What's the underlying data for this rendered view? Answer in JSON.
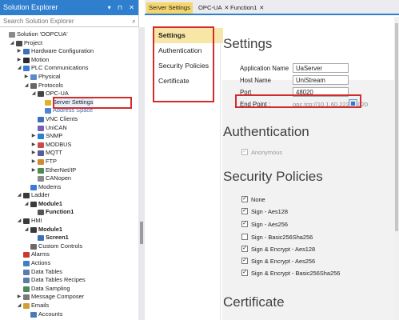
{
  "explorer": {
    "title": "Solution Explorer",
    "title_buttons": "▾ ⊓ ✕",
    "search_placeholder": "Search Solution Explorer",
    "tree": [
      {
        "label": "Solution 'OOPCUA'",
        "level": 0,
        "expand": "",
        "icon": "#8a8a8a",
        "icon_name": "solution-icon"
      },
      {
        "label": "Project",
        "level": 1,
        "expand": "◢",
        "icon": "#4a4a4a",
        "icon_name": "project-icon"
      },
      {
        "label": "Hardware Configuration",
        "level": 2,
        "expand": "▶",
        "icon": "#3b6fb6",
        "icon_name": "hardware-icon"
      },
      {
        "label": "Motion",
        "level": 2,
        "expand": "▶",
        "icon": "#2b2b2b",
        "icon_name": "motion-icon"
      },
      {
        "label": "PLC Communications",
        "level": 2,
        "expand": "◢",
        "icon": "#3a7bd5",
        "icon_name": "plc-communications-icon"
      },
      {
        "label": "Physical",
        "level": 3,
        "expand": "▶",
        "icon": "#5a8ac7",
        "icon_name": "physical-icon"
      },
      {
        "label": "Protocols",
        "level": 3,
        "expand": "◢",
        "icon": "#666666",
        "icon_name": "protocols-icon"
      },
      {
        "label": "OPC-UA",
        "level": 4,
        "expand": "◢",
        "icon": "#444444",
        "icon_name": "opcua-icon"
      },
      {
        "label": "Server Settings",
        "level": 5,
        "expand": "",
        "icon": "#e0b030",
        "icon_name": "server-settings-icon",
        "selected": true
      },
      {
        "label": "Address Space",
        "level": 5,
        "expand": "",
        "icon": "#4c86d0",
        "icon_name": "address-space-icon",
        "muted": true
      },
      {
        "label": "VNC Clients",
        "level": 4,
        "expand": "",
        "icon": "#3c6fb8",
        "icon_name": "vnc-icon"
      },
      {
        "label": "UniCAN",
        "level": 4,
        "expand": "",
        "icon": "#7a5fb0",
        "icon_name": "unican-icon"
      },
      {
        "label": "SNMP",
        "level": 4,
        "expand": "▶",
        "icon": "#2f7fce",
        "icon_name": "snmp-icon"
      },
      {
        "label": "MODBUS",
        "level": 4,
        "expand": "▶",
        "icon": "#c94c4c",
        "icon_name": "modbus-icon"
      },
      {
        "label": "MQTT",
        "level": 4,
        "expand": "▶",
        "icon": "#5b5b9c",
        "icon_name": "mqtt-icon"
      },
      {
        "label": "FTP",
        "level": 4,
        "expand": "▶",
        "icon": "#d08a2c",
        "icon_name": "ftp-icon"
      },
      {
        "label": "EtherNet/IP",
        "level": 4,
        "expand": "▶",
        "icon": "#4d8a4d",
        "icon_name": "ethernet-ip-icon"
      },
      {
        "label": "CANopen",
        "level": 4,
        "expand": "",
        "icon": "#8a8a8a",
        "icon_name": "canopen-icon"
      },
      {
        "label": "Modems",
        "level": 3,
        "expand": "",
        "icon": "#3a7bd5",
        "icon_name": "modems-icon"
      },
      {
        "label": "Ladder",
        "level": 2,
        "expand": "◢",
        "icon": "#3a3a3a",
        "icon_name": "ladder-icon"
      },
      {
        "label": "Module1",
        "level": 3,
        "expand": "◢",
        "icon": "#3a3a3a",
        "icon_name": "module-icon",
        "bold": true
      },
      {
        "label": "Function1",
        "level": 4,
        "expand": "",
        "icon": "#555555",
        "icon_name": "function-icon",
        "bold": true
      },
      {
        "label": "HMI",
        "level": 2,
        "expand": "◢",
        "icon": "#3a3a3a",
        "icon_name": "hmi-icon"
      },
      {
        "label": "Module1",
        "level": 3,
        "expand": "◢",
        "icon": "#3a3a3a",
        "icon_name": "module-icon",
        "bold": true
      },
      {
        "label": "Screen1",
        "level": 4,
        "expand": "",
        "icon": "#3c6fb8",
        "icon_name": "screen-icon",
        "bold": true
      },
      {
        "label": "Custom Controls",
        "level": 3,
        "expand": "",
        "icon": "#6a6a6a",
        "icon_name": "custom-controls-icon"
      },
      {
        "label": "Alarms",
        "level": 2,
        "expand": "",
        "icon": "#c93a2e",
        "icon_name": "alarms-icon"
      },
      {
        "label": "Actions",
        "level": 2,
        "expand": "",
        "icon": "#3f7fc4",
        "icon_name": "actions-icon"
      },
      {
        "label": "Data Tables",
        "level": 2,
        "expand": "",
        "icon": "#5a7da8",
        "icon_name": "data-tables-icon"
      },
      {
        "label": "Data Tables Recipes",
        "level": 2,
        "expand": "",
        "icon": "#5a7da8",
        "icon_name": "recipes-icon"
      },
      {
        "label": "Data Sampling",
        "level": 2,
        "expand": "",
        "icon": "#4a8a5a",
        "icon_name": "data-sampling-icon"
      },
      {
        "label": "Message Composer",
        "level": 2,
        "expand": "▶",
        "icon": "#7a7a7a",
        "icon_name": "message-composer-icon"
      },
      {
        "label": "Emails",
        "level": 2,
        "expand": "◢",
        "icon": "#d0a030",
        "icon_name": "emails-icon"
      },
      {
        "label": "Accounts",
        "level": 3,
        "expand": "",
        "icon": "#4a7ab8",
        "icon_name": "accounts-icon"
      }
    ]
  },
  "tabs": [
    {
      "label": "Server Settings",
      "active": true
    },
    {
      "label": "OPC-UA",
      "active": false
    },
    {
      "label": "Function1",
      "active": false
    }
  ],
  "tab_close_glyph": "✕",
  "nav": {
    "items": [
      "Settings",
      "Authentication",
      "Security Policies",
      "Certificate"
    ],
    "active_index": 0
  },
  "settings": {
    "title": "Settings",
    "application_name_label": "Application Name",
    "application_name_value": "UaServer",
    "host_name_label": "Host Name",
    "host_name_value": "UniStream",
    "port_label": "Port",
    "port_value": "48020",
    "endpoint_label": "End Point :",
    "endpoint_value": "opc.tcp://10.1.60.222:48020"
  },
  "authentication": {
    "title": "Authentication",
    "anonymous_label": "Anonymous",
    "anonymous_checked": true
  },
  "security": {
    "title": "Security Policies",
    "policies": [
      {
        "label": "None",
        "checked": true
      },
      {
        "label": "Sign - Aes128",
        "checked": true
      },
      {
        "label": "Sign - Aes256",
        "checked": true
      },
      {
        "label": "Sign - Basic256Sha256",
        "checked": false
      },
      {
        "label": "Sign & Encrypt - Aes128",
        "checked": true
      },
      {
        "label": "Sign & Encrypt - Aes256",
        "checked": true
      },
      {
        "label": "Sign & Encrypt - Basic256Sha256",
        "checked": true
      }
    ]
  },
  "certificate": {
    "title": "Certificate"
  },
  "colors": {
    "accent": "#2f7fce",
    "highlight_box": "#d42b2b",
    "active_tab": "#f5d66e",
    "active_nav": "#f7e6a5"
  }
}
